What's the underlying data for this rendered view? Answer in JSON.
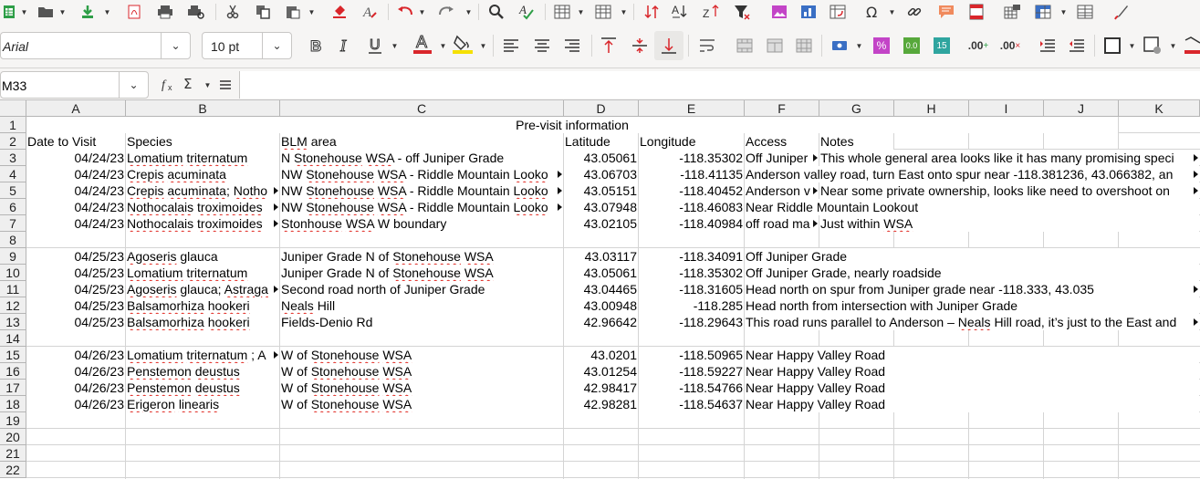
{
  "toolbar": {
    "font_name": "Arial",
    "font_size": "10 pt",
    "icons": [
      "new-spreadsheet-icon",
      "open-icon",
      "save-icon",
      "export-pdf-icon",
      "print-icon",
      "print-preview-icon",
      "cut-icon",
      "copy-icon",
      "paste-icon",
      "clone-format-icon",
      "clear-format-icon",
      "undo-icon",
      "redo-icon",
      "find-replace-icon",
      "spelling-icon",
      "row-icon",
      "column-icon",
      "sort-ascending-icon",
      "sort-icon",
      "sort-descending-icon",
      "autofilter-icon",
      "insert-image-icon",
      "insert-chart-icon",
      "pivot-table-icon",
      "special-character-icon",
      "hyperlink-icon",
      "comment-icon",
      "header-footer-icon",
      "define-print-area-icon",
      "freeze-rows-columns-icon",
      "split-window-icon",
      "show-draw-functions-icon"
    ],
    "number_format_labels": {
      "percent": "%",
      "decimal": "0.0",
      "general": "15",
      "add_decimal": ".00",
      "delete_decimal": ".00"
    }
  },
  "formula_bar": {
    "cell_ref": "M33",
    "formula": ""
  },
  "sheet": {
    "columns": [
      "A",
      "B",
      "C",
      "D",
      "E",
      "F",
      "G",
      "H",
      "I",
      "J",
      "K"
    ],
    "rows": [
      "1",
      "2",
      "3",
      "4",
      "5",
      "6",
      "7",
      "8",
      "9",
      "10",
      "11",
      "12",
      "13",
      "14",
      "15",
      "16",
      "17",
      "18",
      "19",
      "20",
      "21",
      "22"
    ],
    "title": "Pre-visit information",
    "headers": {
      "date": "Date to Visit",
      "species": "Species",
      "blm": "BLM area",
      "lat": "Latitude",
      "lon": "Longitude",
      "access": "Access",
      "notes": "Notes"
    },
    "data": [
      {
        "row": 3,
        "date": "04/24/23",
        "species": "Lomatium triternatum",
        "blm": "N Stonehouse WSA - off Juniper Grade",
        "lat": "43.05061",
        "lon": "-118.35302",
        "access": "Off Juniper",
        "notes": "This whole general area looks like it has many promising speci"
      },
      {
        "row": 4,
        "date": "04/24/23",
        "species": "Crepis acuminata",
        "blm": "NW Stonehouse WSA - Riddle Mountain Looko",
        "lat": "43.06703",
        "lon": "-118.41135",
        "access": "Anderson valley road, turn East onto spur near -118.381236, 43.066382, an",
        "notes": ""
      },
      {
        "row": 5,
        "date": "04/24/23",
        "species": "Crepis acuminata; Notho",
        "blm": "NW Stonehouse WSA - Riddle Mountain Looko",
        "lat": "43.05151",
        "lon": "-118.40452",
        "access": "Anderson v",
        "notes": "Near some private ownership, looks like need to overshoot on"
      },
      {
        "row": 6,
        "date": "04/24/23",
        "species": "Nothocalais troximoides",
        "blm": "NW Stonehouse WSA - Riddle Mountain Looko",
        "lat": "43.07948",
        "lon": "-118.46083",
        "access": "Near Riddle Mountain Lookout",
        "notes": ""
      },
      {
        "row": 7,
        "date": "04/24/23",
        "species": "Nothocalais troximoides",
        "blm": "Stonhouse WSA W boundary",
        "lat": "43.02105",
        "lon": "-118.40984",
        "access": "off road ma",
        "notes": "Just within WSA"
      },
      {
        "row": 9,
        "date": "04/25/23",
        "species": "Agoseris glauca",
        "blm": "Juniper Grade N of Stonehouse WSA",
        "lat": "43.03117",
        "lon": "-118.34091",
        "access": "Off Juniper Grade",
        "notes": ""
      },
      {
        "row": 10,
        "date": "04/25/23",
        "species": "Lomatium triternatum",
        "blm": "Juniper Grade N of Stonehouse WSA",
        "lat": "43.05061",
        "lon": "-118.35302",
        "access": "Off Juniper Grade, nearly roadside",
        "notes": ""
      },
      {
        "row": 11,
        "date": "04/25/23",
        "species": "Agoseris glauca; Astraga",
        "blm": "Second road north of Juniper Grade",
        "lat": "43.04465",
        "lon": "-118.31605",
        "access": "Head north on spur from Juniper grade near  -118.333, 43.035",
        "notes": ""
      },
      {
        "row": 12,
        "date": "04/25/23",
        "species": "Balsamorhiza hookeri",
        "blm": "Neals Hill",
        "lat": "43.00948",
        "lon": "-118.285",
        "access": "Head north from intersection with Juniper Grade",
        "notes": ""
      },
      {
        "row": 13,
        "date": "04/25/23",
        "species": "Balsamorhiza hookeri",
        "blm": "Fields-Denio Rd",
        "lat": "42.96642",
        "lon": "-118.29643",
        "access": "This road runs parallel to Anderson – Neals Hill road, it’s just to the East and",
        "notes": ""
      },
      {
        "row": 15,
        "date": "04/26/23",
        "species": "Lomatium triternatum ; A",
        "blm": "W of Stonehouse WSA",
        "lat": "43.0201",
        "lon": "-118.50965",
        "access": "Near Happy Valley Road",
        "notes": ""
      },
      {
        "row": 16,
        "date": "04/26/23",
        "species": "Penstemon deustus",
        "blm": "W of Stonehouse WSA",
        "lat": "43.01254",
        "lon": "-118.59227",
        "access": "Near Happy Valley Road",
        "notes": ""
      },
      {
        "row": 17,
        "date": "04/26/23",
        "species": "Penstemon deustus",
        "blm": "W of Stonehouse WSA",
        "lat": "42.98417",
        "lon": "-118.54766",
        "access": "Near Happy Valley Road",
        "notes": ""
      },
      {
        "row": 18,
        "date": "04/26/23",
        "species": "Erigeron linearis",
        "blm": "W of Stonehouse WSA",
        "lat": "42.98281",
        "lon": "-118.54637",
        "access": "Near Happy Valley Road",
        "notes": ""
      }
    ],
    "colors": {
      "selected_cell": "#000000",
      "header_bg": "#efefef",
      "grid": "#d4d4d4",
      "squiggle": "#e0261e"
    }
  }
}
